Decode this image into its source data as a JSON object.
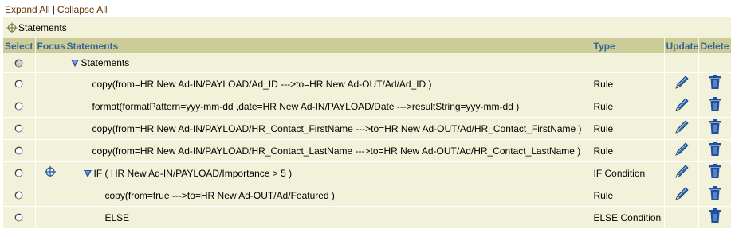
{
  "links": {
    "expand_all": "Expand All",
    "separator": "|",
    "collapse_all": "Collapse All"
  },
  "breadcrumb": {
    "label": "Statements",
    "icon": "crosshair-icon"
  },
  "table": {
    "headers": {
      "select": "Select",
      "focus": "Focus",
      "statements": "Statements",
      "type": "Type",
      "update": "Update",
      "delete": "Delete"
    },
    "rows": [
      {
        "statement": "Statements",
        "type": "",
        "indent": 1,
        "toggle": true,
        "focus": false,
        "update": false,
        "delete": false,
        "radio_disabled": true
      },
      {
        "statement": "copy(from=HR New Ad-IN/PAYLOAD/Ad_ID --->to=HR New Ad-OUT/Ad/Ad_ID )",
        "type": "Rule",
        "indent": 2,
        "toggle": false,
        "focus": false,
        "update": true,
        "delete": true
      },
      {
        "statement": "format(formatPattern=yyy-mm-dd ,date=HR New Ad-IN/PAYLOAD/Date --->resultString=yyy-mm-dd )",
        "type": "Rule",
        "indent": 2,
        "toggle": false,
        "focus": false,
        "update": true,
        "delete": true
      },
      {
        "statement": "copy(from=HR New Ad-IN/PAYLOAD/HR_Contact_FirstName --->to=HR New Ad-OUT/Ad/HR_Contact_FirstName )",
        "type": "Rule",
        "indent": 2,
        "toggle": false,
        "focus": false,
        "update": true,
        "delete": true
      },
      {
        "statement": "copy(from=HR New Ad-IN/PAYLOAD/HR_Contact_LastName --->to=HR New Ad-OUT/Ad/HR_Contact_LastName )",
        "type": "Rule",
        "indent": 2,
        "toggle": false,
        "focus": false,
        "update": true,
        "delete": true
      },
      {
        "statement": "IF ( HR New Ad-IN/PAYLOAD/Importance > 5 )",
        "type": "IF Condition",
        "indent": 3,
        "toggle": true,
        "focus": true,
        "update": true,
        "delete": true
      },
      {
        "statement": "copy(from=true --->to=HR New Ad-OUT/Ad/Featured )",
        "type": "Rule",
        "indent": 4,
        "toggle": false,
        "focus": false,
        "update": true,
        "delete": true
      },
      {
        "statement": "ELSE",
        "type": "ELSE Condition",
        "indent": 4,
        "toggle": false,
        "focus": false,
        "update": false,
        "delete": true
      }
    ]
  },
  "colors": {
    "header_bg": "#cccc99",
    "header_text": "#336699",
    "row_bg": "#f2f2da",
    "link": "#663300",
    "pencil": "#2a6aa8",
    "trash": "#1f4f9e",
    "toggle": "#1f4f9e"
  }
}
